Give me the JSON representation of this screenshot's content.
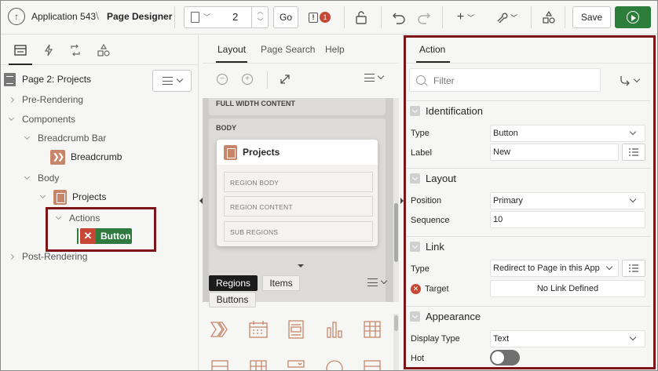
{
  "toolbar": {
    "app_name": "Application 543",
    "crumb_sep": "\\",
    "page_designer": "Page Designer",
    "page_number": "2",
    "go_label": "Go",
    "warning_count": "1",
    "save_label": "Save"
  },
  "left": {
    "page_title": "Page 2: Projects",
    "tree": {
      "pre_rendering": "Pre-Rendering",
      "components": "Components",
      "breadcrumb_bar": "Breadcrumb Bar",
      "breadcrumb": "Breadcrumb",
      "body": "Body",
      "projects": "Projects",
      "actions": "Actions",
      "button": "Button",
      "post_rendering": "Post-Rendering"
    }
  },
  "middle": {
    "tabs": [
      "Layout",
      "Page Search",
      "Help"
    ],
    "full_width": "FULL WIDTH CONTENT",
    "body": "BODY",
    "region_title": "Projects",
    "slots": [
      "REGION BODY",
      "REGION CONTENT",
      "SUB REGIONS"
    ],
    "gallery_tabs": [
      "Regions",
      "Items",
      "Buttons"
    ]
  },
  "right": {
    "tab": "Action",
    "filter_placeholder": "Filter",
    "sections": {
      "identification": "Identification",
      "layout": "Layout",
      "link": "Link",
      "appearance": "Appearance"
    },
    "props": {
      "type_label": "Type",
      "type_value": "Button",
      "label_label": "Label",
      "label_value": "New",
      "position_label": "Position",
      "position_value": "Primary",
      "sequence_label": "Sequence",
      "sequence_value": "10",
      "link_type_label": "Type",
      "link_type_value": "Redirect to Page in this App",
      "target_label": "Target",
      "target_value": "No Link Defined",
      "display_type_label": "Display Type",
      "display_type_value": "Text",
      "hot_label": "Hot",
      "hot_on": false
    }
  },
  "colors": {
    "accent_dark": "#7b1518",
    "run_green": "#2d7d3a",
    "component_orange": "#c7866a",
    "error_red": "#c74634"
  }
}
